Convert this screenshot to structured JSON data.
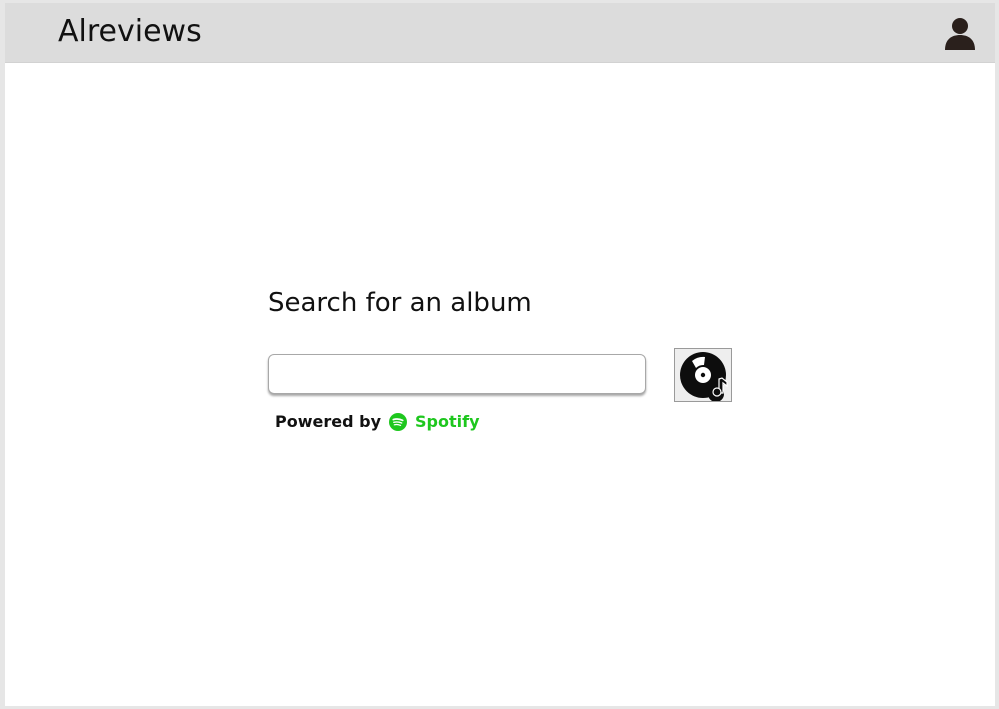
{
  "header": {
    "app_title": "Alreviews",
    "profile_icon": "user-icon"
  },
  "search": {
    "heading": "Search for an album",
    "input_value": "",
    "placeholder": "",
    "submit_icon": "vinyl-record-icon"
  },
  "attribution": {
    "powered_by_label": "Powered by",
    "provider_name": "Spotify",
    "provider_icon": "spotify-icon"
  },
  "colors": {
    "header_background": "#dcdcdc",
    "spotify_green": "#1ec71e",
    "text": "#111111"
  }
}
